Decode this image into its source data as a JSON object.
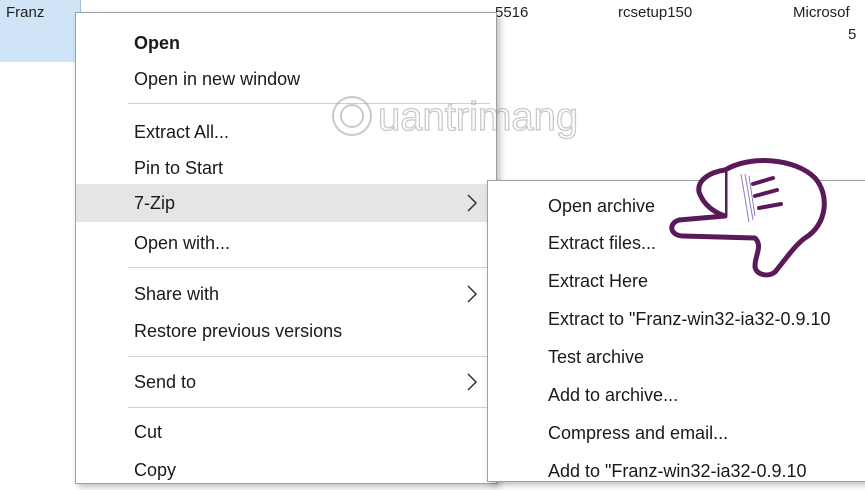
{
  "explorer": {
    "items": [
      {
        "label": "Franz"
      },
      {
        "label": "5516"
      },
      {
        "label": "rcsetup150"
      },
      {
        "label": "Microsof"
      },
      {
        "label": "5"
      }
    ]
  },
  "context_menu": {
    "items": [
      {
        "label": "Open"
      },
      {
        "label": "Open in new window"
      },
      {
        "label": "Extract All..."
      },
      {
        "label": "Pin to Start"
      },
      {
        "label": "7-Zip"
      },
      {
        "label": "Open with..."
      },
      {
        "label": "Share with"
      },
      {
        "label": "Restore previous versions"
      },
      {
        "label": "Send to"
      },
      {
        "label": "Cut"
      },
      {
        "label": "Copy"
      }
    ]
  },
  "submenu_7zip": {
    "items": [
      {
        "label": "Open archive"
      },
      {
        "label": "Extract files..."
      },
      {
        "label": "Extract Here"
      },
      {
        "label": "Extract to \"Franz-win32-ia32-0.9.10"
      },
      {
        "label": "Test archive"
      },
      {
        "label": "Add to archive..."
      },
      {
        "label": "Compress and email..."
      },
      {
        "label": "Add to \"Franz-win32-ia32-0.9.10"
      }
    ]
  },
  "watermark": {
    "text": "uantrimang"
  },
  "colors": {
    "highlight": "#e5e5e5",
    "selection_tile": "#cfe4f7",
    "hand_outline": "#5a1a5a"
  },
  "icons": {
    "submenu_arrow": "chevron-right-icon",
    "pointer": "pointing-hand-icon",
    "watermark_logo": "watermark-logo-icon"
  }
}
